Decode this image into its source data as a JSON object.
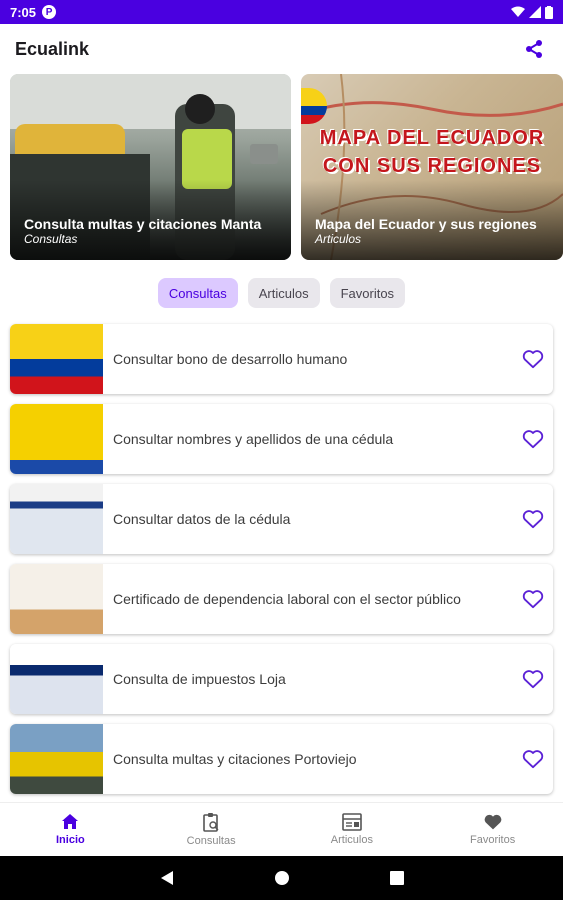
{
  "status_bar": {
    "time": "7:05",
    "notif_letter": "P"
  },
  "app_bar": {
    "title": "Ecualink",
    "share_icon": "share-icon"
  },
  "hero_cards": [
    {
      "title": "Consulta multas y citaciones Manta",
      "category": "Consultas"
    },
    {
      "title": "Mapa del Ecuador y sus regiones",
      "category": "Articulos",
      "banner_line1": "MAPA DEL ECUADOR",
      "banner_line2": "CON SUS REGIONES"
    }
  ],
  "tabs": [
    {
      "label": "Consultas",
      "active": true
    },
    {
      "label": "Articulos",
      "active": false
    },
    {
      "label": "Favoritos",
      "active": false
    }
  ],
  "items": [
    {
      "label": "Consultar bono de desarrollo humano",
      "thumb_colors": [
        "#f7d117",
        "#033c9c",
        "#d1141b"
      ]
    },
    {
      "label": "Consultar nombres y apellidos de una cédula",
      "thumb_colors": [
        "#f5d000",
        "#2aa7d8",
        "#1b4aa8"
      ]
    },
    {
      "label": "Consultar datos de la cédula",
      "thumb_colors": [
        "#f2f2f2",
        "#1a3c86",
        "#e0e6ef"
      ]
    },
    {
      "label": "Certificado de dependencia laboral con el sector público",
      "thumb_colors": [
        "#e9dfd2",
        "#d4a36a",
        "#f5f0e8"
      ]
    },
    {
      "label": "Consulta de impuestos Loja",
      "thumb_colors": [
        "#ffffff",
        "#0a2a6e",
        "#dde3ee"
      ]
    },
    {
      "label": "Consulta multas y citaciones Portoviejo",
      "thumb_colors": [
        "#7aa0c4",
        "#e6c400",
        "#3f4a3f"
      ]
    }
  ],
  "bottom_nav": [
    {
      "label": "Inicio",
      "icon": "home-icon",
      "active": true
    },
    {
      "label": "Consultas",
      "icon": "clipboard-search-icon",
      "active": false
    },
    {
      "label": "Articulos",
      "icon": "article-icon",
      "active": false
    },
    {
      "label": "Favoritos",
      "icon": "heart-icon",
      "active": false
    }
  ],
  "colors": {
    "accent": "#4a00e0",
    "accent_light": "#dcc9ff",
    "heart": "#5b21d6"
  }
}
